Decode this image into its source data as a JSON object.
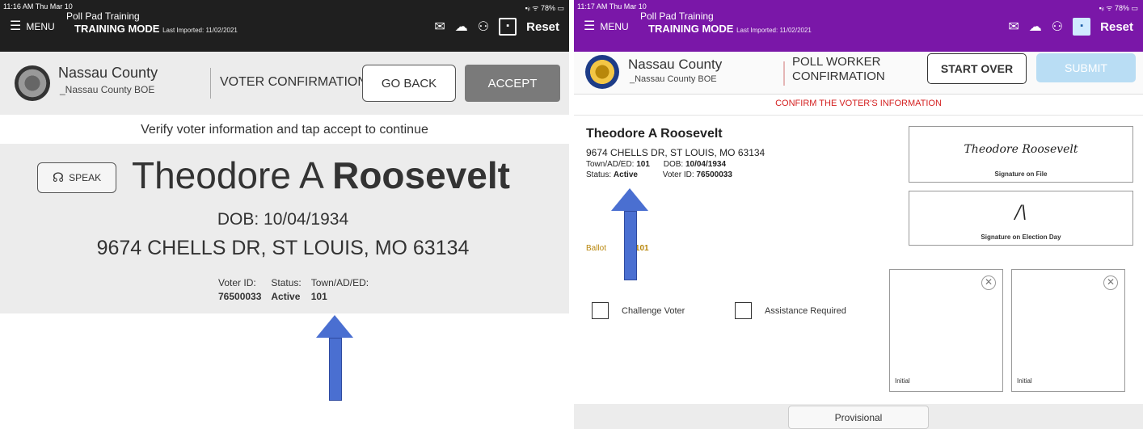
{
  "left": {
    "status_time": "11:16 AM  Thu Mar 10",
    "status_right": "▪ᵢₗ ᯤ 78% ▭",
    "menu_label": "MENU",
    "app_title": "Poll Pad Training",
    "mode_label": "TRAINING MODE",
    "last_imported": "Last Imported: 11/02/2021",
    "reset_label": "Reset",
    "org_name": "Nassau County",
    "org_sub": "_Nassau County BOE",
    "screen_title": "VOTER CONFIRMATION",
    "go_back_label": "GO BACK",
    "accept_label": "ACCEPT",
    "instruction": "Verify voter information and tap accept to continue",
    "speak_label": "SPEAK",
    "voter_first": "Theodore A",
    "voter_last": "Roosevelt",
    "dob": "DOB: 10/04/1934",
    "address": "9674 CHELLS DR, ST LOUIS, MO 63134",
    "voter_id_label": "Voter ID:",
    "voter_id": "76500033",
    "status_label": "Status:",
    "status": "Active",
    "town_label": "Town/AD/ED:",
    "town": "101"
  },
  "right": {
    "status_time": "11:17 AM  Thu Mar 10",
    "status_right": "▪ᵢₗ ᯤ 78% ▭",
    "menu_label": "MENU",
    "app_title": "Poll Pad Training",
    "mode_label": "TRAINING MODE",
    "last_imported": "Last Imported: 11/02/2021",
    "reset_label": "Reset",
    "org_name": "Nassau County",
    "org_sub": "_Nassau County BOE",
    "screen_title_1": "POLL WORKER",
    "screen_title_2": "CONFIRMATION",
    "start_over_label": "START OVER",
    "submit_label": "SUBMIT",
    "confirm_msg": "CONFIRM THE VOTER'S INFORMATION",
    "voter_name": "Theodore A Roosevelt",
    "address": "9674 CHELLS DR, ST LOUIS, MO 63134",
    "town_label": "Town/AD/ED:",
    "town": "101",
    "dob_label": "DOB:",
    "dob": "10/04/1934",
    "status_label": "Status:",
    "status": "Active",
    "voter_id_label": "Voter ID:",
    "voter_id": "76500033",
    "sig_on_file_label": "Signature on File",
    "sig_on_file_scribble": "Theodore Roosevelt",
    "sig_election_label": "Signature on Election Day",
    "sig_election_scribble": "/\\",
    "ballot_label": "Ballot",
    "ballot_label_2": "e:",
    "ballot_value": "101",
    "challenge_label": "Challenge Voter",
    "assistance_label": "Assistance Required",
    "initial_label_1": "Initial",
    "initial_label_2": "Initial",
    "provisional_label": "Provisional"
  },
  "colors": {
    "left_topbar": "#1f1f1f",
    "right_topbar": "#7a17a8",
    "arrow": "#4a6fd1",
    "confirm_red": "#d42020",
    "submit_disabled": "#b9ddf4",
    "ballot_gold": "#b8860b"
  }
}
